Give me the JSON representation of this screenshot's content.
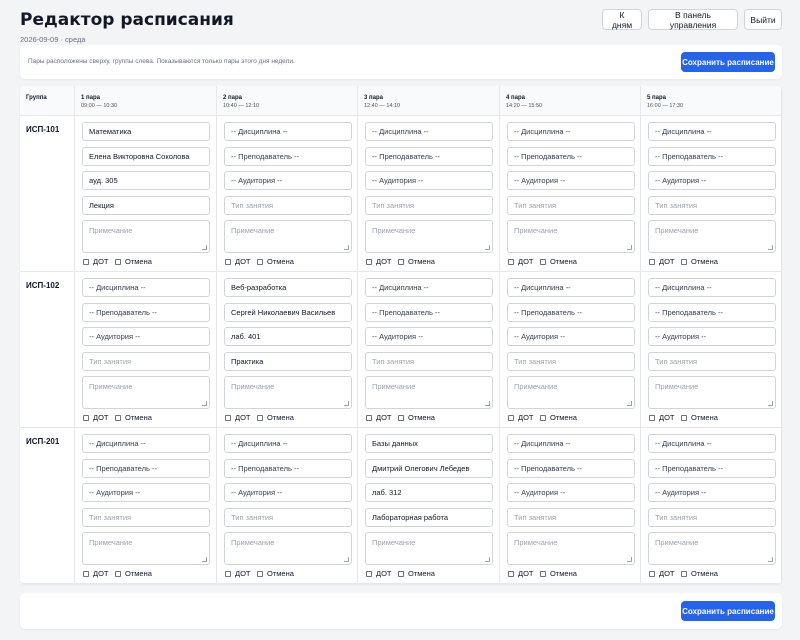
{
  "header": {
    "title": "Редактор расписания",
    "subtitle": "2026-09-09 · среда",
    "buttons": [
      "К дням",
      "В панель управления",
      "Выйти"
    ]
  },
  "info": {
    "hint": "Пары расположены сверху, группы слева. Показываются только пары этого дня недели.",
    "save_label": "Сохранить расписание"
  },
  "table": {
    "group_header": "Группа",
    "periods": [
      {
        "name": "1 пара",
        "time": "09:00 — 10:30"
      },
      {
        "name": "2 пара",
        "time": "10:40 — 12:10"
      },
      {
        "name": "3 пара",
        "time": "12:40 — 14:10"
      },
      {
        "name": "4 пара",
        "time": "14:20 — 15:50"
      },
      {
        "name": "5 пара",
        "time": "16:00 — 17:30"
      }
    ],
    "groups": [
      {
        "name": "ИСП-101",
        "cells": [
          {
            "discipline": "Математика",
            "teacher": "Елена Викторовна Соколова",
            "room": "ауд. 305",
            "type": "Лекция",
            "note": "Примечание",
            "dot": "ДОТ",
            "cancel": "Отмена"
          },
          {
            "discipline": "-- Дисциплина --",
            "teacher": "-- Преподаватель --",
            "room": "-- Аудитория --",
            "type": "Тип занятия",
            "note": "Примечание",
            "dot": "ДОТ",
            "cancel": "Отмена"
          },
          {
            "discipline": "-- Дисциплина --",
            "teacher": "-- Преподаватель --",
            "room": "-- Аудитория --",
            "type": "Тип занятия",
            "note": "Примечание",
            "dot": "ДОТ",
            "cancel": "Отмена"
          },
          {
            "discipline": "-- Дисциплина --",
            "teacher": "-- Преподаватель --",
            "room": "-- Аудитория --",
            "type": "Тип занятия",
            "note": "Примечание",
            "dot": "ДОТ",
            "cancel": "Отмена"
          },
          {
            "discipline": "-- Дисциплина --",
            "teacher": "-- Преподаватель --",
            "room": "-- Аудитория --",
            "type": "Тип занятия",
            "note": "Примечание",
            "dot": "ДОТ",
            "cancel": "Отмена"
          }
        ]
      },
      {
        "name": "ИСП-102",
        "cells": [
          {
            "discipline": "-- Дисциплина --",
            "teacher": "-- Преподаватель --",
            "room": "-- Аудитория --",
            "type": "Тип занятия",
            "note": "Примечание",
            "dot": "ДОТ",
            "cancel": "Отмена"
          },
          {
            "discipline": "Веб-разработка",
            "teacher": "Сергей Николаевич Васильев",
            "room": "лаб. 401",
            "type": "Практика",
            "note": "Примечание",
            "dot": "ДОТ",
            "cancel": "Отмена"
          },
          {
            "discipline": "-- Дисциплина --",
            "teacher": "-- Преподаватель --",
            "room": "-- Аудитория --",
            "type": "Тип занятия",
            "note": "Примечание",
            "dot": "ДОТ",
            "cancel": "Отмена"
          },
          {
            "discipline": "-- Дисциплина --",
            "teacher": "-- Преподаватель --",
            "room": "-- Аудитория --",
            "type": "Тип занятия",
            "note": "Примечание",
            "dot": "ДОТ",
            "cancel": "Отмена"
          },
          {
            "discipline": "-- Дисциплина --",
            "teacher": "-- Преподаватель --",
            "room": "-- Аудитория --",
            "type": "Тип занятия",
            "note": "Примечание",
            "dot": "ДОТ",
            "cancel": "Отмена"
          }
        ]
      },
      {
        "name": "ИСП-201",
        "cells": [
          {
            "discipline": "-- Дисциплина --",
            "teacher": "-- Преподаватель --",
            "room": "-- Аудитория --",
            "type": "Тип занятия",
            "note": "Примечание",
            "dot": "ДОТ",
            "cancel": "Отмена"
          },
          {
            "discipline": "-- Дисциплина --",
            "teacher": "-- Преподаватель --",
            "room": "-- Аудитория --",
            "type": "Тип занятия",
            "note": "Примечание",
            "dot": "ДОТ",
            "cancel": "Отмена"
          },
          {
            "discipline": "Базы данных",
            "teacher": "Дмитрий Олегович Лебедев",
            "room": "лаб. 312",
            "type": "Лабораторная работа",
            "note": "Примечание",
            "dot": "ДОТ",
            "cancel": "Отмена"
          },
          {
            "discipline": "-- Дисциплина --",
            "teacher": "-- Преподаватель --",
            "room": "-- Аудитория --",
            "type": "Тип занятия",
            "note": "Примечание",
            "dot": "ДОТ",
            "cancel": "Отмена"
          },
          {
            "discipline": "-- Дисциплина --",
            "teacher": "-- Преподаватель --",
            "room": "-- Аудитория --",
            "type": "Тип занятия",
            "note": "Примечание",
            "dot": "ДОТ",
            "cancel": "Отмена"
          }
        ]
      }
    ]
  },
  "footer": {
    "save_label": "Сохранить расписание"
  },
  "colors": {
    "accent": "#2563eb",
    "border": "#d1d5db",
    "background": "#f3f4f6"
  }
}
